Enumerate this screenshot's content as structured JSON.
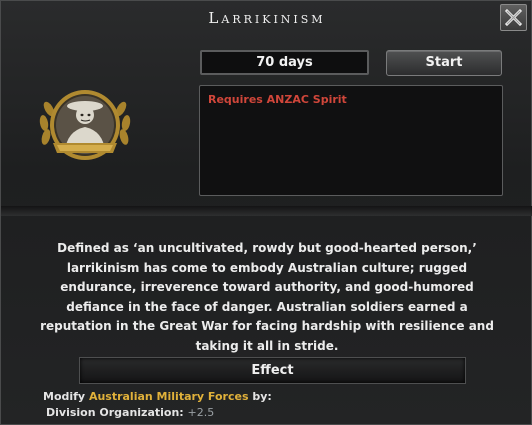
{
  "window": {
    "title": "Larrikinism"
  },
  "header": {
    "duration": "70 days",
    "start_label": "Start",
    "requirement": "Requires ANZAC Spirit"
  },
  "icons": {
    "close": "close-x-icon",
    "portrait": "soldier-portrait-icon"
  },
  "description": "Defined as ‘an uncultivated, rowdy but good-hearted person,’ larrikinism has come to embody Australian culture; rugged endurance, irreverence toward authority, and good-humored defiance in the face of danger. Australian soldiers earned a reputation in the Great War for facing hardship with resilience and taking it all in stride.",
  "effect": {
    "header": "Effect",
    "modify_prefix": "Modify ",
    "modify_target": "Australian Military Forces",
    "modify_suffix": " by:",
    "stat_label": "Division Organization: ",
    "stat_value": "+2.5"
  },
  "colors": {
    "requirement_red": "#d0463a",
    "highlight_gold": "#e0b13a",
    "stat_grey": "#9aa0a4"
  }
}
